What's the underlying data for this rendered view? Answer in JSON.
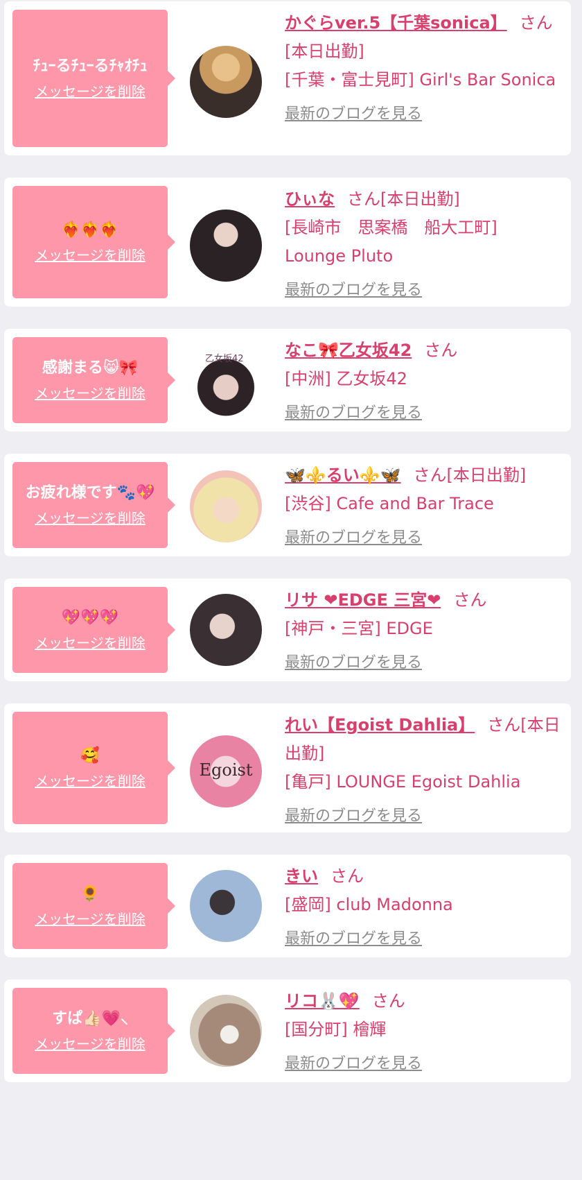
{
  "common": {
    "delete_label": "メッセージを削除",
    "blog_label": "最新のブログを見る",
    "san": "さん"
  },
  "colors": {
    "page_bg": "#efeff3",
    "bubble": "#fd97a9",
    "accent": "#d83f6d",
    "link_gray": "#8c8c8c"
  },
  "messages": [
    {
      "message": "ﾁｭｰるﾁｭｰるﾁｬｵﾁｭ",
      "name": "かぐらver.5【千葉sonica】",
      "status": "[本日出勤]",
      "shop": "[千葉・富士見町] Girl's Bar Sonica"
    },
    {
      "message": "❤️‍🔥❤️‍🔥❤️‍🔥",
      "name": "ひぃな",
      "status": "[本日出勤]",
      "shop": "[長崎市　思案橋　船大工町] Lounge Pluto"
    },
    {
      "message": "感謝まる😸🎀",
      "name": "なこ🎀乙女坂42",
      "status": "",
      "shop": "[中洲] 乙女坂42",
      "avatar_text": "乙女坂42"
    },
    {
      "message": "お疲れ様です🐾💖",
      "name": "🦋⚜️るい⚜️🦋",
      "status": "[本日出勤]",
      "shop": "[渋谷] Cafe and Bar Trace"
    },
    {
      "message": "💖💖💖",
      "name": "リサ ❤EDGE 三宮❤",
      "status": "",
      "shop": "[神戸・三宮] EDGE"
    },
    {
      "message": "🥰",
      "name": "れい【Egoist Dahlia】",
      "status": "[本日出勤]",
      "shop": "[亀戸] LOUNGE Egoist Dahlia",
      "avatar_text": "Egoist"
    },
    {
      "message": "🌻",
      "name": "きい",
      "status": "",
      "shop": "[盛岡] club Madonna"
    },
    {
      "message": "すぱ👍🏻💗⸜",
      "name": "リコ🐰💖",
      "status": "",
      "shop": "[国分町] 檜輝"
    }
  ]
}
